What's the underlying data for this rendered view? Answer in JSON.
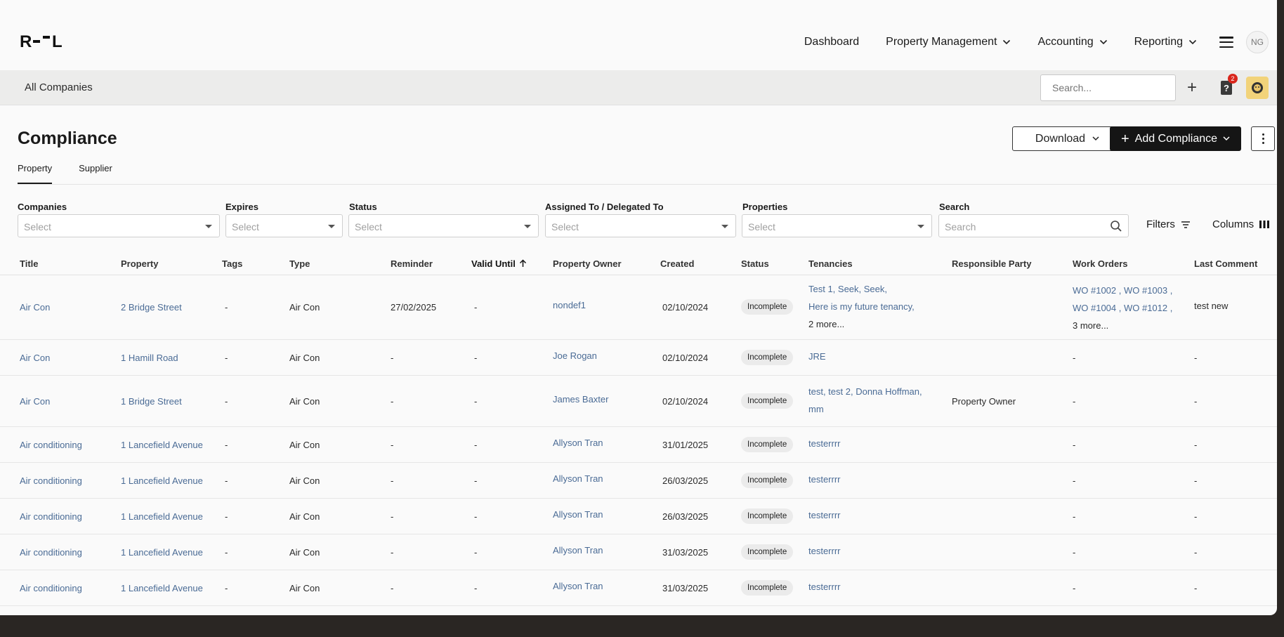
{
  "nav": {
    "logo_text": "R--L",
    "items": [
      {
        "label": "Dashboard",
        "has_dropdown": false
      },
      {
        "label": "Property Management",
        "has_dropdown": true
      },
      {
        "label": "Accounting",
        "has_dropdown": true
      },
      {
        "label": "Reporting",
        "has_dropdown": true
      }
    ],
    "avatar_initials": "NG"
  },
  "company_bar": {
    "label": "All Companies",
    "search_placeholder": "Search...",
    "help_badge_count": "2"
  },
  "page": {
    "title": "Compliance",
    "download_label": "Download",
    "add_label": "Add Compliance",
    "tabs": [
      {
        "label": "Property",
        "active": true
      },
      {
        "label": "Supplier",
        "active": false
      }
    ]
  },
  "filters": {
    "companies": {
      "label": "Companies",
      "placeholder": "Select"
    },
    "expires": {
      "label": "Expires",
      "placeholder": "Select"
    },
    "status": {
      "label": "Status",
      "placeholder": "Select"
    },
    "assigned": {
      "label": "Assigned To / Delegated To",
      "placeholder": "Select"
    },
    "properties": {
      "label": "Properties",
      "placeholder": "Select"
    },
    "search": {
      "label": "Search",
      "placeholder": "Search"
    },
    "filters_label": "Filters",
    "columns_label": "Columns"
  },
  "table": {
    "headers": {
      "title": "Title",
      "property": "Property",
      "tags": "Tags",
      "type": "Type",
      "reminder": "Reminder",
      "valid_until": "Valid Until",
      "owner": "Property Owner",
      "created": "Created",
      "status": "Status",
      "tenancies": "Tenancies",
      "responsible": "Responsible Party",
      "work_orders": "Work Orders",
      "last_comment": "Last Comment"
    },
    "rows": [
      {
        "title": "Air Con",
        "property": "2 Bridge Street",
        "tags": "-",
        "type": "Air Con",
        "reminder": "27/02/2025",
        "valid_until": "-",
        "owner": "nondef1",
        "created": "02/10/2024",
        "status": "Incomplete",
        "tenancies": [
          "Test 1,  Seek,  Seek,",
          "Here is my future tenancy,"
        ],
        "tenancies_more": "2 more...",
        "responsible": "",
        "work_orders": [
          "WO #1002 , WO #1003 ,",
          "WO #1004 , WO #1012 ,"
        ],
        "work_orders_more": "3 more...",
        "last_comment": "test new"
      },
      {
        "title": "Air Con",
        "property": "1 Hamill Road",
        "tags": "-",
        "type": "Air Con",
        "reminder": "-",
        "valid_until": "-",
        "owner": "Joe Rogan",
        "created": "02/10/2024",
        "status": "Incomplete",
        "tenancies": [
          "JRE"
        ],
        "tenancies_more": "",
        "responsible": "",
        "work_orders": [
          "-"
        ],
        "work_orders_more": "",
        "last_comment": "-"
      },
      {
        "title": "Air Con",
        "property": "1 Bridge Street",
        "tags": "-",
        "type": "Air Con",
        "reminder": "-",
        "valid_until": "-",
        "owner": "James Baxter",
        "created": "02/10/2024",
        "status": "Incomplete",
        "tenancies": [
          "test,  test 2,  Donna Hoffman,",
          "mm"
        ],
        "tenancies_more": "",
        "responsible": "Property Owner",
        "work_orders": [
          "-"
        ],
        "work_orders_more": "",
        "last_comment": "-"
      },
      {
        "title": "Air conditioning",
        "property": "1 Lancefield Avenue",
        "tags": "-",
        "type": "Air Con",
        "reminder": "-",
        "valid_until": "-",
        "owner": "Allyson Tran",
        "created": "31/01/2025",
        "status": "Incomplete",
        "tenancies": [
          "testerrrr"
        ],
        "tenancies_more": "",
        "responsible": "",
        "work_orders": [
          "-"
        ],
        "work_orders_more": "",
        "last_comment": "-"
      },
      {
        "title": "Air conditioning",
        "property": "1 Lancefield Avenue",
        "tags": "-",
        "type": "Air Con",
        "reminder": "-",
        "valid_until": "-",
        "owner": "Allyson Tran",
        "created": "26/03/2025",
        "status": "Incomplete",
        "tenancies": [
          "testerrrr"
        ],
        "tenancies_more": "",
        "responsible": "",
        "work_orders": [
          "-"
        ],
        "work_orders_more": "",
        "last_comment": "-"
      },
      {
        "title": "Air conditioning",
        "property": "1 Lancefield Avenue",
        "tags": "-",
        "type": "Air Con",
        "reminder": "-",
        "valid_until": "-",
        "owner": "Allyson Tran",
        "created": "26/03/2025",
        "status": "Incomplete",
        "tenancies": [
          "testerrrr"
        ],
        "tenancies_more": "",
        "responsible": "",
        "work_orders": [
          "-"
        ],
        "work_orders_more": "",
        "last_comment": "-"
      },
      {
        "title": "Air conditioning",
        "property": "1 Lancefield Avenue",
        "tags": "-",
        "type": "Air Con",
        "reminder": "-",
        "valid_until": "-",
        "owner": "Allyson Tran",
        "created": "31/03/2025",
        "status": "Incomplete",
        "tenancies": [
          "testerrrr"
        ],
        "tenancies_more": "",
        "responsible": "",
        "work_orders": [
          "-"
        ],
        "work_orders_more": "",
        "last_comment": "-"
      },
      {
        "title": "Air conditioning",
        "property": "1 Lancefield Avenue",
        "tags": "-",
        "type": "Air Con",
        "reminder": "-",
        "valid_until": "-",
        "owner": "Allyson Tran",
        "created": "31/03/2025",
        "status": "Incomplete",
        "tenancies": [
          "testerrrr"
        ],
        "tenancies_more": "",
        "responsible": "",
        "work_orders": [
          "-"
        ],
        "work_orders_more": "",
        "last_comment": "-"
      }
    ]
  }
}
